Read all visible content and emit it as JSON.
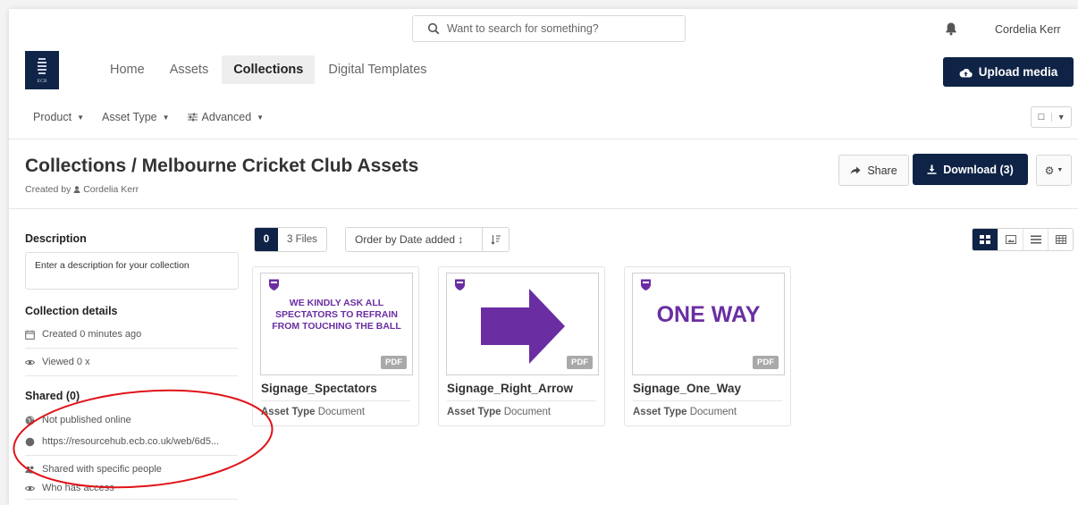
{
  "search": {
    "placeholder": "Want to search for something?"
  },
  "user": {
    "name": "Cordelia Kerr"
  },
  "logo": {
    "text": "ECB"
  },
  "nav": {
    "items": [
      {
        "label": "Home",
        "active": false
      },
      {
        "label": "Assets",
        "active": false
      },
      {
        "label": "Collections",
        "active": true
      },
      {
        "label": "Digital Templates",
        "active": false
      }
    ],
    "upload_label": "Upload media"
  },
  "filters": {
    "product": "Product",
    "asset_type": "Asset Type",
    "advanced": "Advanced"
  },
  "header": {
    "title": "Collections / Melbourne Cricket Club Assets",
    "created_by_prefix": "Created by",
    "created_by_name": "Cordelia Kerr",
    "share_label": "Share",
    "download_label": "Download (3)"
  },
  "sidebar": {
    "description_heading": "Description",
    "description_placeholder": "Enter a description for your collection",
    "details_heading": "Collection details",
    "created": "Created 0 minutes ago",
    "viewed": "Viewed 0 x",
    "shared_heading": "Shared (0)",
    "not_published": "Not published online",
    "url": "https://resourcehub.ecb.co.uk/web/6d5...",
    "shared_with": "Shared with specific people",
    "who_access": "Who has access"
  },
  "toolbar": {
    "selected_count": "0",
    "file_count": "3 Files",
    "order_label": "Order by Date added ↕"
  },
  "assets": [
    {
      "name": "Signage_Spectators",
      "thumb_text": "WE KINDLY ASK ALL SPECTATORS TO REFRAIN FROM TOUCHING THE BALL",
      "type_label": "Asset Type",
      "type_value": "Document",
      "badge": "PDF"
    },
    {
      "name": "Signage_Right_Arrow",
      "thumb_text": "",
      "type_label": "Asset Type",
      "type_value": "Document",
      "badge": "PDF"
    },
    {
      "name": "Signage_One_Way",
      "thumb_text": "ONE WAY",
      "type_label": "Asset Type",
      "type_value": "Document",
      "badge": "PDF"
    }
  ],
  "colors": {
    "navy": "#0f2346",
    "purple": "#6a2ea2",
    "annotation_red": "#e0131a"
  }
}
